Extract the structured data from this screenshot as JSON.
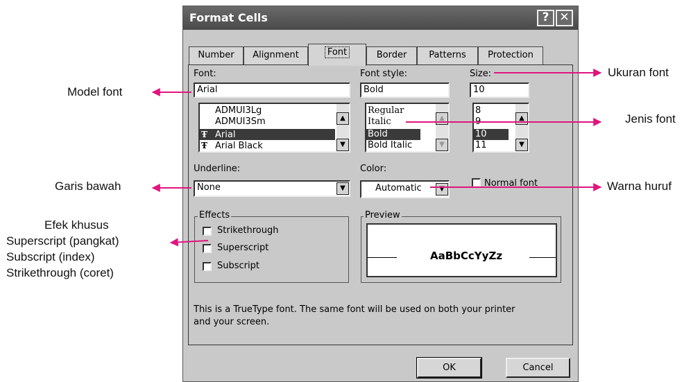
{
  "window": {
    "title": "Format Cells",
    "help_label": "?",
    "close_label": "✕"
  },
  "tabs": [
    "Number",
    "Alignment",
    "Font",
    "Border",
    "Patterns",
    "Protection"
  ],
  "font": {
    "label": "Font:",
    "value": "Arial",
    "items": [
      "ADMUI3Lg",
      "ADMUI3Sm",
      "Arial",
      "Arial Black"
    ],
    "selected": "Arial",
    "truetype_glyph": "Ŧ"
  },
  "font_style": {
    "label": "Font style:",
    "value": "Bold",
    "items": [
      "Regular",
      "Italic",
      "Bold",
      "Bold Italic"
    ],
    "selected": "Bold"
  },
  "size": {
    "label": "Size:",
    "value": "10",
    "items": [
      "8",
      "9",
      "10",
      "11"
    ],
    "selected": "10"
  },
  "underline": {
    "label": "Underline:",
    "value": "None"
  },
  "color": {
    "label": "Color:",
    "value": "Automatic"
  },
  "normal_font": {
    "label": "Normal font",
    "checked": false
  },
  "effects": {
    "label": "Effects",
    "items": [
      {
        "label": "Strikethrough",
        "checked": false
      },
      {
        "label": "Superscript",
        "checked": false
      },
      {
        "label": "Subscript",
        "checked": false
      }
    ]
  },
  "preview": {
    "label": "Preview",
    "text": "AaBbCcYyZz"
  },
  "info": {
    "line1": "This is a TrueType font.  The same font will be used on both your printer",
    "line2": "and your screen."
  },
  "buttons": {
    "ok": "OK",
    "cancel": "Cancel"
  },
  "annotations": {
    "model_font": "Model font",
    "ukuran_font": "Ukuran font",
    "jenis_font": "Jenis font",
    "garis_bawah": "Garis bawah",
    "warna_huruf": "Warna huruf",
    "efek": [
      "Efek khusus",
      "Superscript (pangkat)",
      "Subscript (index)",
      "Strikethrough (coret)"
    ]
  },
  "colors": {
    "arrow": "#e0147e",
    "dialog_bg": "#c9c9c9",
    "titlebar": "#555555",
    "selection": "#3a3a3a"
  }
}
